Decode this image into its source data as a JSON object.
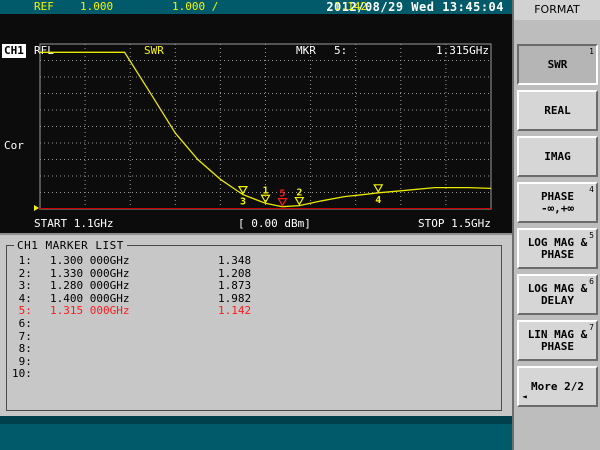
{
  "status": {
    "datetime": "2012/08/29 Wed 13:45:04"
  },
  "header": {
    "channel": "CH1",
    "measure": "RFL",
    "format": "SWR",
    "marker_label": "MKR",
    "marker_num": "5:",
    "marker_freq": "1.315GHz",
    "ref_label": "REF",
    "ref_value": "1.000",
    "scale": "1.000 /",
    "marker_value": "1.142"
  },
  "side_label": "Cor",
  "sweep": {
    "start": "START 1.1GHz",
    "power": "[ 0.00 dBm]",
    "stop": "STOP 1.5GHz"
  },
  "trace": {
    "start_ghz": 1.1,
    "stop_ghz": 1.5,
    "ref_value": 1.0,
    "scale_per_div": 1.0,
    "points": [
      [
        1.1,
        10.5
      ],
      [
        1.175,
        10.5
      ],
      [
        1.2,
        7.8
      ],
      [
        1.22,
        5.6
      ],
      [
        1.24,
        4.0
      ],
      [
        1.26,
        2.8
      ],
      [
        1.28,
        1.873
      ],
      [
        1.3,
        1.348
      ],
      [
        1.315,
        1.142
      ],
      [
        1.33,
        1.208
      ],
      [
        1.35,
        1.5
      ],
      [
        1.37,
        1.75
      ],
      [
        1.39,
        1.9
      ],
      [
        1.4,
        1.982
      ],
      [
        1.42,
        2.1
      ],
      [
        1.45,
        2.3
      ],
      [
        1.48,
        2.3
      ],
      [
        1.5,
        2.25
      ]
    ]
  },
  "marker_list": {
    "title": "CH1 MARKER LIST",
    "rows": [
      {
        "idx": " 1:",
        "freq": "1.300 000GHz",
        "val": "1.348",
        "ghz": 1.3,
        "v": 1.348
      },
      {
        "idx": " 2:",
        "freq": "1.330 000GHz",
        "val": "1.208",
        "ghz": 1.33,
        "v": 1.208
      },
      {
        "idx": " 3:",
        "freq": "1.280 000GHz",
        "val": "1.873",
        "ghz": 1.28,
        "v": 1.873
      },
      {
        "idx": " 4:",
        "freq": "1.400 000GHz",
        "val": "1.982",
        "ghz": 1.4,
        "v": 1.982
      },
      {
        "idx": " 5:",
        "freq": "1.315 000GHz",
        "val": "1.142",
        "ghz": 1.315,
        "v": 1.142
      },
      {
        "idx": " 6:",
        "freq": "",
        "val": ""
      },
      {
        "idx": " 7:",
        "freq": "",
        "val": ""
      },
      {
        "idx": " 8:",
        "freq": "",
        "val": ""
      },
      {
        "idx": " 9:",
        "freq": "",
        "val": ""
      },
      {
        "idx": "10:",
        "freq": "",
        "val": ""
      }
    ],
    "active_index": 4
  },
  "softkeys": {
    "title": "FORMAT",
    "keys": [
      {
        "line1": "SWR",
        "line2": "",
        "num": "1",
        "selected": true
      },
      {
        "line1": "REAL",
        "line2": "",
        "num": "",
        "selected": false
      },
      {
        "line1": "IMAG",
        "line2": "",
        "num": "",
        "selected": false
      },
      {
        "line1": "PHASE",
        "line2": "-∞,+∞",
        "num": "4",
        "selected": false
      },
      {
        "line1": "LOG MAG &",
        "line2": "PHASE",
        "num": "5",
        "selected": false
      },
      {
        "line1": "LOG MAG &",
        "line2": "DELAY",
        "num": "6",
        "selected": false
      },
      {
        "line1": "LIN MAG &",
        "line2": "PHASE",
        "num": "7",
        "selected": false
      },
      {
        "line1": "More 2/2",
        "line2": "",
        "num": "",
        "selected": false,
        "arrow": "◄"
      }
    ]
  },
  "colors": {
    "trace": "#e8e800",
    "marker": "#f4f400",
    "active_marker": "#ff1a1a",
    "grid": "#9a9a9a",
    "teal_bar": "#005a6a"
  }
}
